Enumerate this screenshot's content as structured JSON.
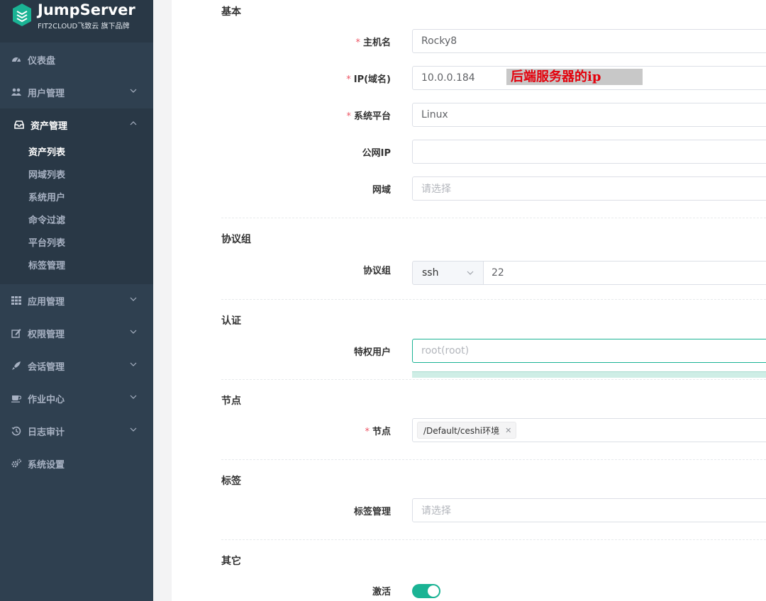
{
  "app": {
    "brand": "JumpServer",
    "tagline": "FIT2CLOUD飞致云 旗下品牌",
    "accent": "#1ab394"
  },
  "sidebar": {
    "items": [
      {
        "label": "仪表盘",
        "icon": "dashboard-icon"
      },
      {
        "label": "用户管理",
        "icon": "users-icon"
      },
      {
        "label": "资产管理",
        "icon": "inbox-icon"
      },
      {
        "label": "应用管理",
        "icon": "grid-icon"
      },
      {
        "label": "权限管理",
        "icon": "edit-icon"
      },
      {
        "label": "会话管理",
        "icon": "rocket-icon"
      },
      {
        "label": "作业中心",
        "icon": "coffee-icon"
      },
      {
        "label": "日志审计",
        "icon": "history-icon"
      },
      {
        "label": "系统设置",
        "icon": "cogs-icon"
      }
    ],
    "asset_submenu": [
      "资产列表",
      "网域列表",
      "系统用户",
      "命令过滤",
      "平台列表",
      "标签管理"
    ]
  },
  "form": {
    "sections": {
      "basic": "基本",
      "protocols": "协议组",
      "auth": "认证",
      "nodes": "节点",
      "labels": "标签",
      "other": "其它"
    },
    "hostname": {
      "label": "主机名",
      "value": "Rocky8"
    },
    "ip": {
      "label": "IP(域名)",
      "value": "10.0.0.184"
    },
    "platform": {
      "label": "系统平台",
      "value": "Linux"
    },
    "public_ip": {
      "label": "公网IP",
      "value": ""
    },
    "domain": {
      "label": "网域",
      "placeholder": "请选择"
    },
    "protocol": {
      "label": "协议组",
      "name": "ssh",
      "port": "22"
    },
    "admin_user": {
      "label": "特权用户",
      "placeholder": "root(root)"
    },
    "node": {
      "label": "节点",
      "chip": "/Default/ceshi环境"
    },
    "tags": {
      "label": "标签管理",
      "placeholder": "请选择"
    },
    "active": {
      "label": "激活",
      "on": true
    }
  },
  "annotation": "后端服务器的ip"
}
